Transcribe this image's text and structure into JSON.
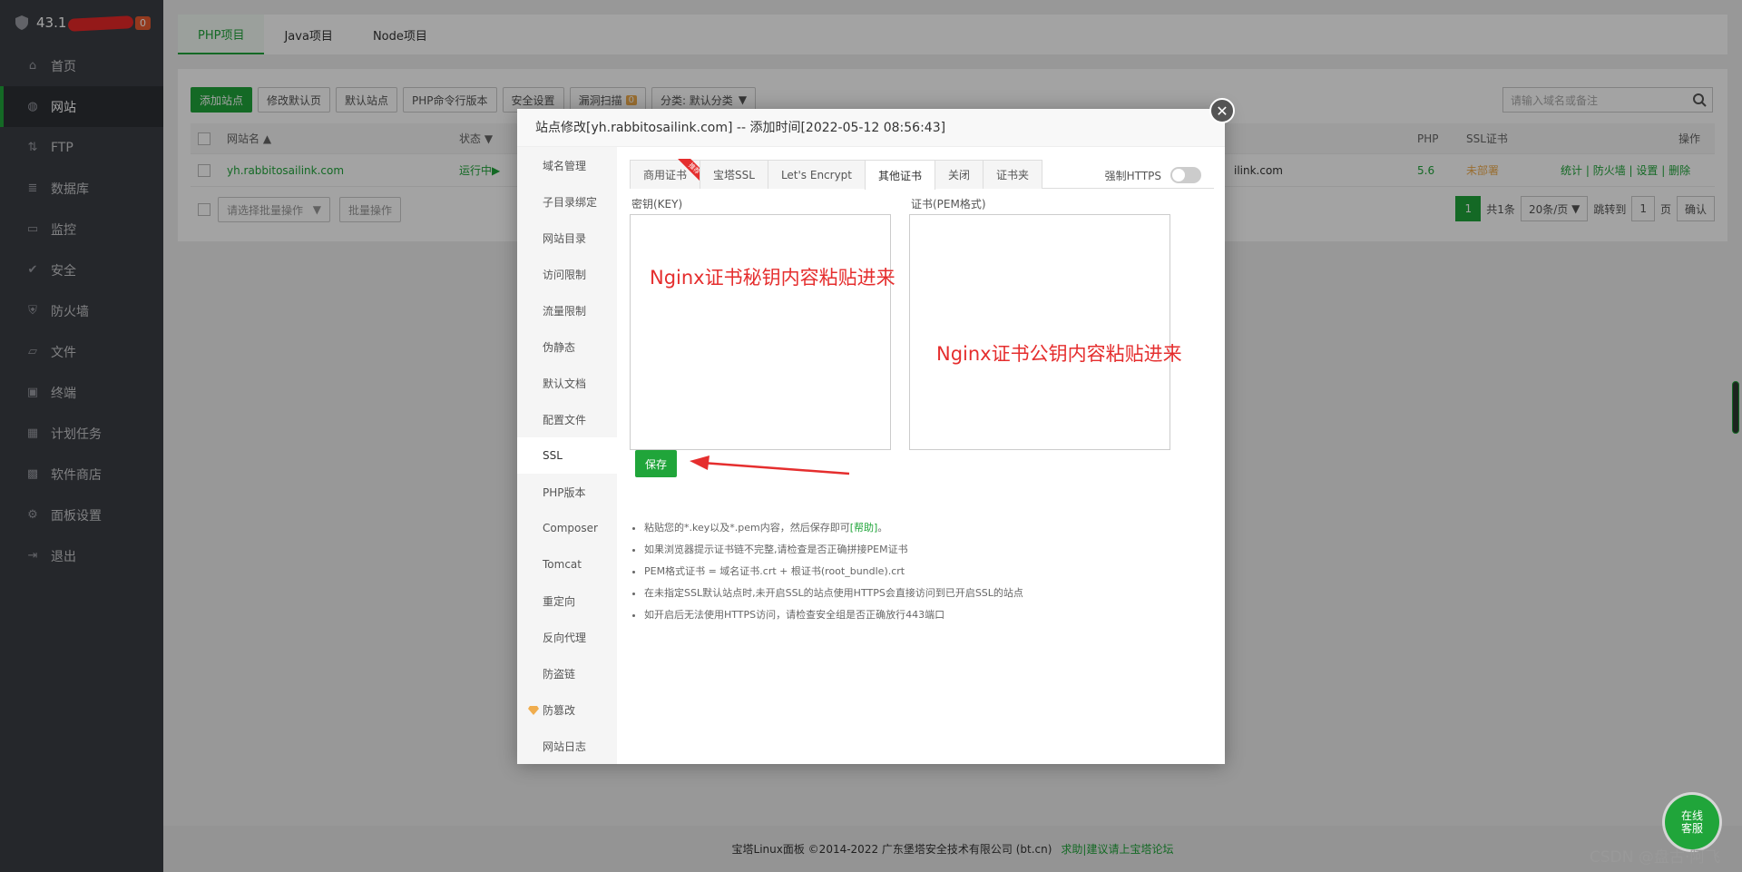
{
  "sidebar": {
    "ip_text": "43.1",
    "badge": "0",
    "items": [
      {
        "label": "首页",
        "icon": "home-icon"
      },
      {
        "label": "网站",
        "icon": "globe-icon"
      },
      {
        "label": "FTP",
        "icon": "ftp-icon"
      },
      {
        "label": "数据库",
        "icon": "database-icon"
      },
      {
        "label": "监控",
        "icon": "monitor-icon"
      },
      {
        "label": "安全",
        "icon": "shield-check-icon"
      },
      {
        "label": "防火墙",
        "icon": "firewall-icon"
      },
      {
        "label": "文件",
        "icon": "folder-icon"
      },
      {
        "label": "终端",
        "icon": "terminal-icon"
      },
      {
        "label": "计划任务",
        "icon": "calendar-icon"
      },
      {
        "label": "软件商店",
        "icon": "apps-icon"
      },
      {
        "label": "面板设置",
        "icon": "gear-icon"
      },
      {
        "label": "退出",
        "icon": "logout-icon"
      }
    ]
  },
  "top_tabs": [
    "PHP项目",
    "Java项目",
    "Node项目"
  ],
  "toolbar": {
    "add_site": "添加站点",
    "modify_default": "修改默认页",
    "default_site": "默认站点",
    "php_cli": "PHP命令行版本",
    "security": "安全设置",
    "vuln_scan": "漏洞扫描",
    "vuln_count": "0",
    "category": "分类: 默认分类"
  },
  "search": {
    "placeholder": "请输入域名或备注"
  },
  "table": {
    "headers": {
      "site": "网站名",
      "status": "状态",
      "php": "PHP",
      "ssl": "SSL证书",
      "ops": "操作"
    },
    "row": {
      "site": "yh.rabbitosailink.com",
      "status": "运行中▶",
      "domain_tail": "ilink.com",
      "php": "5.6",
      "ssl": "未部署",
      "ops": [
        "统计",
        "防火墙",
        "设置",
        "删除"
      ]
    }
  },
  "batch": {
    "select_placeholder": "请选择批量操作",
    "button": "批量操作"
  },
  "pager": {
    "current": "1",
    "total": "共1条",
    "per_page": "20条/页",
    "goto_label": "跳转到",
    "goto_value": "1",
    "page_unit": "页",
    "confirm": "确认"
  },
  "modal": {
    "title": "站点修改[yh.rabbitosailink.com] -- 添加时间[2022-05-12 08:56:43]",
    "side_items": [
      "域名管理",
      "子目录绑定",
      "网站目录",
      "访问限制",
      "流量限制",
      "伪静态",
      "默认文档",
      "配置文件",
      "SSL",
      "PHP版本",
      "Composer",
      "Tomcat",
      "重定向",
      "反向代理",
      "防盗链",
      "防篡改",
      "网站日志"
    ],
    "ssl_tabs": [
      "商用证书",
      "宝塔SSL",
      "Let's Encrypt",
      "其他证书",
      "关闭",
      "证书夹"
    ],
    "ribbon": "推荐",
    "force_https": "强制HTTPS",
    "key_label": "密钥(KEY)",
    "cert_label": "证书(PEM格式)",
    "key_note": "Nginx证书秘钥内容粘贴进来",
    "cert_note": "Nginx证书公钥内容粘贴进来",
    "save": "保存",
    "tips": [
      "粘贴您的*.key以及*.pem内容，然后保存即可",
      "如果浏览器提示证书链不完整,请检查是否正确拼接PEM证书",
      "PEM格式证书 = 域名证书.crt + 根证书(root_bundle).crt",
      "在未指定SSL默认站点时,未开启SSL的站点使用HTTPS会直接访问到已开启SSL的站点",
      "如开启后无法使用HTTPS访问，请检查安全组是否正确放行443端口"
    ],
    "help_link": "[帮助]",
    "tip_end": "。"
  },
  "footer": {
    "copyright": "宝塔Linux面板 ©2014-2022 广东堡塔安全技术有限公司 (bt.cn)",
    "link": "求助|建议请上宝塔论坛"
  },
  "online": {
    "line1": "在线",
    "line2": "客服"
  },
  "watermark": "CSDN @盘古·阿飞",
  "colors": {
    "accent": "#20a53a",
    "annotation": "#e52e2e",
    "sidebar": "#3a3d44"
  }
}
